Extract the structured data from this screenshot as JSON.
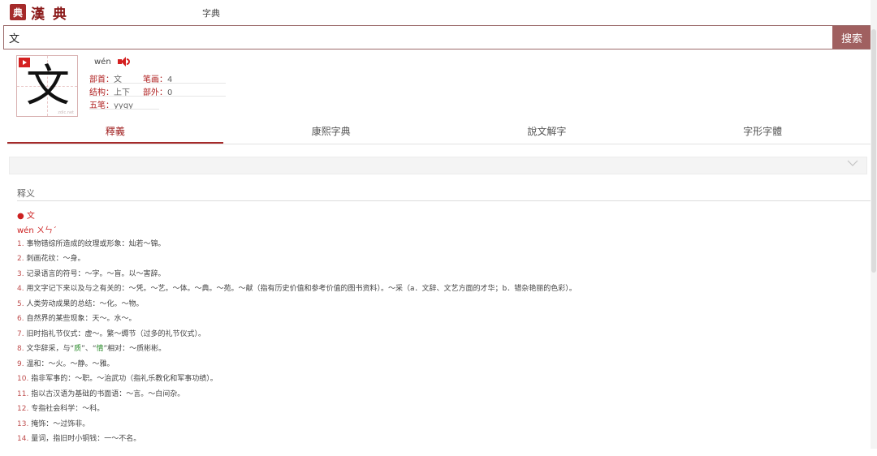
{
  "header": {
    "logo_mark": "典",
    "logo_text": "漢 典",
    "nav_label": "字典"
  },
  "search": {
    "value": "文",
    "button_label": "搜索"
  },
  "character": {
    "glyph": "文",
    "watermark": "zdic.net"
  },
  "info": {
    "pinyin": "wén",
    "radical_key": "部首：",
    "radical_val": "文",
    "strokes_key": "笔画：",
    "strokes_val": "4",
    "structure_key": "结构：",
    "structure_val": "上下",
    "extra_key": "部外：",
    "extra_val": "0",
    "wubi_key": "五笔：",
    "wubi_val": "yygy"
  },
  "tabs": [
    {
      "label": "釋義"
    },
    {
      "label": "康熙字典"
    },
    {
      "label": "說文解字"
    },
    {
      "label": "字形字體"
    }
  ],
  "content": {
    "heading": "释义",
    "char_line": "● 文",
    "pinyin_line": "wén ㄨㄣˊ",
    "defs": [
      {
        "n": "1.",
        "t": "事物错综所造成的纹理或形象：灿若～锦。"
      },
      {
        "n": "2.",
        "t": "刺画花纹：～身。"
      },
      {
        "n": "3.",
        "t": "记录语言的符号：～字。～盲。以～害辞。"
      },
      {
        "n": "4.",
        "t": "用文字记下来以及与之有关的：～凭。～艺。～体。～典。～苑。～献（指有历史价值和参考价值的图书资料）。～采（a．文辞、文艺方面的才华；b．错杂艳丽的色彩）。"
      },
      {
        "n": "5.",
        "t": "人类劳动成果的总结：～化。～物。"
      },
      {
        "n": "6.",
        "t": "自然界的某些现象：天～。水～。"
      },
      {
        "n": "7.",
        "t": "旧时指礼节仪式：虚～。繁～缛节（过多的礼节仪式）。"
      },
      {
        "n": "8.",
        "t_a": "文华辞采，与“",
        "g1": "质",
        "t_b": "”、“",
        "g2": "情",
        "t_c": "”相对：～质彬彬。"
      },
      {
        "n": "9.",
        "t": "温和：～火。～静。～雅。"
      },
      {
        "n": "10.",
        "t": "指非军事的：～职。～治武功（指礼乐教化和军事功绩）。"
      },
      {
        "n": "11.",
        "t": "指以古汉语为基础的书面语：～言。～白间杂。"
      },
      {
        "n": "12.",
        "t": "专指社会科学：～科。"
      },
      {
        "n": "13.",
        "t": "掩饰：～过饰非。"
      },
      {
        "n": "14.",
        "t": "量词，指旧时小铜钱：一～不名。"
      }
    ]
  }
}
